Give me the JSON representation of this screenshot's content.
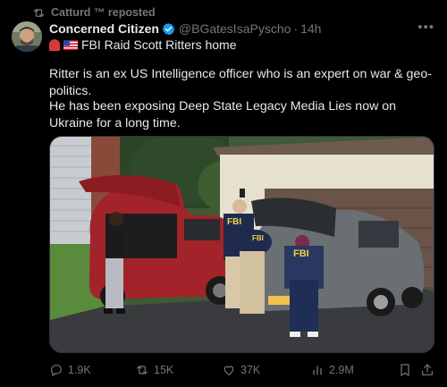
{
  "repost": {
    "text": "Catturd ™ reposted",
    "icon": "repost-icon"
  },
  "author": {
    "name": "Concerned Citizen",
    "handle": "@BGatesIsaPyscho",
    "separator": "·",
    "time": "14h",
    "verified_color": "#1d9bf0"
  },
  "post": {
    "headline": "FBI Raid Scott Ritters home",
    "paragraph_1": "Ritter is an ex US Intelligence officer who is an expert on war & geo-politics.",
    "paragraph_2": "He has been exposing Deep State Legacy Media Lies now on Ukraine for a long time."
  },
  "photo": {
    "jacket_text_1": "FBI",
    "jacket_text_2": "FBI",
    "plate_text": "FBI"
  },
  "actions": {
    "replies": "1.9K",
    "reposts": "15K",
    "likes": "37K",
    "views": "2.9M"
  },
  "colors": {
    "muted": "#71767b",
    "text": "#e7e9ea",
    "accent": "#1d9bf0"
  }
}
